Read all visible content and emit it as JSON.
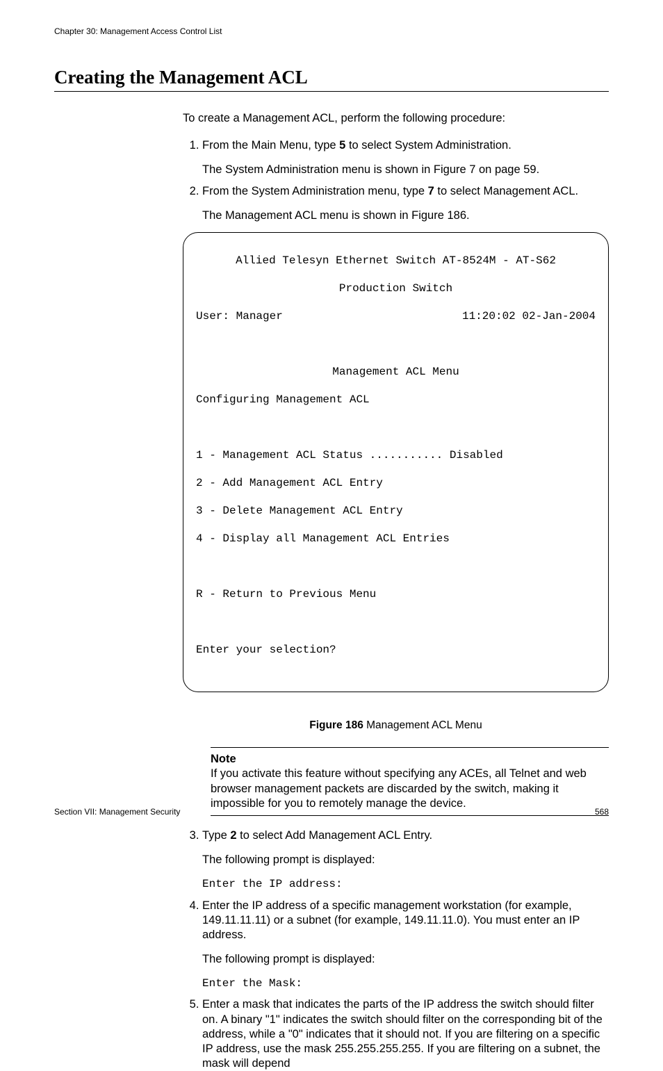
{
  "header": {
    "chapter": "Chapter 30: Management Access Control List"
  },
  "title": "Creating the Management ACL",
  "intro": "To create a Management ACL, perform the following procedure:",
  "steps": {
    "s1": {
      "num": "1.",
      "pre": "From the Main Menu, type ",
      "key": "5",
      "post": " to select System Administration.",
      "result": "The System Administration menu is shown in Figure 7 on page 59."
    },
    "s2": {
      "num": "2.",
      "pre": "From the System Administration menu, type ",
      "key": "7",
      "post": " to select Management ACL.",
      "result": "The Management ACL menu is shown in Figure 186."
    },
    "s3": {
      "num": "3.",
      "pre": "Type ",
      "key": "2",
      "post": " to select Add Management ACL Entry.",
      "result": "The following prompt is displayed:",
      "prompt": "Enter the IP address:"
    },
    "s4": {
      "num": "4.",
      "text": "Enter the IP address of a specific management workstation (for example, 149.11.11.11) or a subnet (for example, 149.11.11.0). You must enter an IP address.",
      "result": "The following prompt is displayed:",
      "prompt": "Enter the Mask:"
    },
    "s5": {
      "num": "5.",
      "text": "Enter a mask that indicates the parts of the IP address the switch should filter on. A binary \"1\" indicates the switch should filter on the corresponding bit of the address, while a \"0\" indicates that it should not. If you are filtering on a specific IP address, use the mask 255.255.255.255. If you are filtering on a subnet, the mask will depend"
    }
  },
  "terminal": {
    "banner1": "Allied Telesyn Ethernet Switch AT-8524M - AT-S62",
    "banner2": "Production Switch",
    "user": "User: Manager",
    "timestamp": "11:20:02 02-Jan-2004",
    "menu_title": "Management ACL Menu",
    "subtitle": "Configuring Management ACL",
    "opt1": "1 - Management ACL Status ........... Disabled",
    "opt2": "2 - Add Management ACL Entry",
    "opt3": "3 - Delete Management ACL Entry",
    "opt4": "4 - Display all Management ACL Entries",
    "optR": "R - Return to Previous Menu",
    "prompt": "Enter your selection?"
  },
  "figure": {
    "label": "Figure 186",
    "caption": "  Management ACL Menu"
  },
  "note": {
    "title": "Note",
    "body": "If you activate this feature without specifying any ACEs, all Telnet and web browser management packets are discarded by the switch, making it impossible for you to remotely manage the device."
  },
  "footer": {
    "section": "Section VII: Management Security",
    "page": "568"
  }
}
